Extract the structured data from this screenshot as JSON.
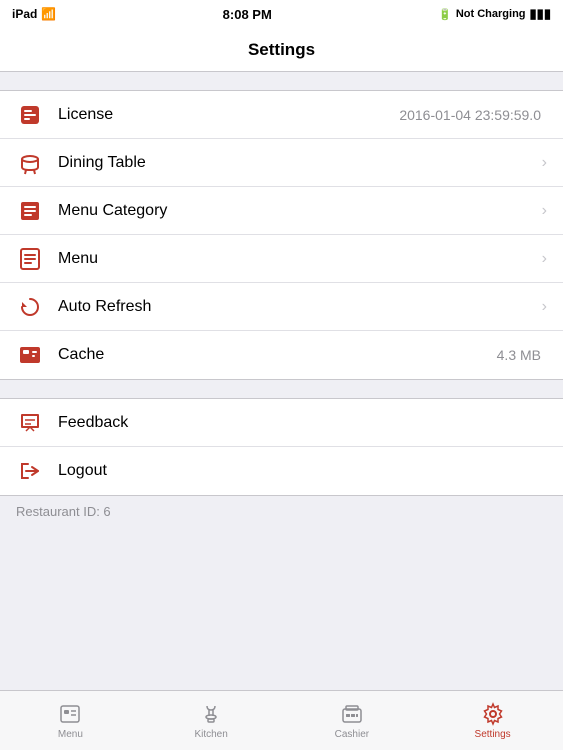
{
  "statusBar": {
    "left": "iPad",
    "time": "8:08 PM",
    "right": "Not Charging"
  },
  "navBar": {
    "title": "Settings"
  },
  "settingsSections": [
    {
      "rows": [
        {
          "id": "license",
          "label": "License",
          "value": "2016-01-04 23:59:59.0",
          "hasChevron": false,
          "icon": "license"
        },
        {
          "id": "dining-table",
          "label": "Dining Table",
          "value": "",
          "hasChevron": true,
          "icon": "dining-table"
        },
        {
          "id": "menu-category",
          "label": "Menu Category",
          "value": "",
          "hasChevron": true,
          "icon": "menu-category"
        },
        {
          "id": "menu",
          "label": "Menu",
          "value": "",
          "hasChevron": true,
          "icon": "menu"
        },
        {
          "id": "auto-refresh",
          "label": "Auto Refresh",
          "value": "",
          "hasChevron": true,
          "icon": "auto-refresh"
        },
        {
          "id": "cache",
          "label": "Cache",
          "value": "4.3 MB",
          "hasChevron": false,
          "icon": "cache"
        }
      ]
    },
    {
      "rows": [
        {
          "id": "feedback",
          "label": "Feedback",
          "value": "",
          "hasChevron": false,
          "icon": "feedback"
        },
        {
          "id": "logout",
          "label": "Logout",
          "value": "",
          "hasChevron": false,
          "icon": "logout"
        }
      ]
    }
  ],
  "footer": {
    "text": "Restaurant ID: 6"
  },
  "tabBar": {
    "items": [
      {
        "id": "menu",
        "label": "Menu",
        "active": false
      },
      {
        "id": "kitchen",
        "label": "Kitchen",
        "active": false
      },
      {
        "id": "cashier",
        "label": "Cashier",
        "active": false
      },
      {
        "id": "settings",
        "label": "Settings",
        "active": true
      }
    ]
  }
}
